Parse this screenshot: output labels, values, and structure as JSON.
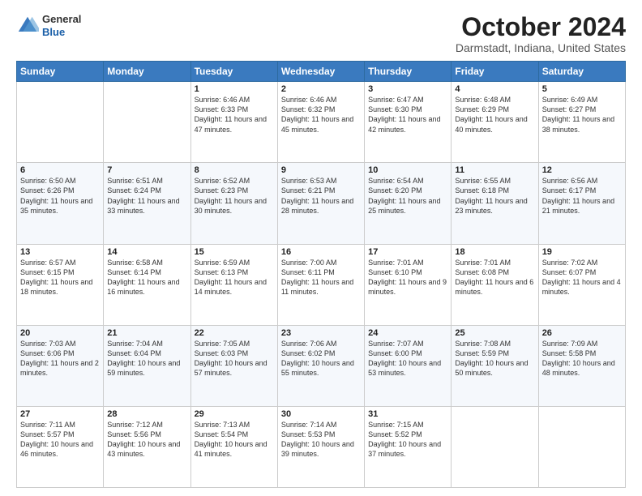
{
  "header": {
    "logo": {
      "general": "General",
      "blue": "Blue"
    },
    "title": "October 2024",
    "location": "Darmstadt, Indiana, United States"
  },
  "weekdays": [
    "Sunday",
    "Monday",
    "Tuesday",
    "Wednesday",
    "Thursday",
    "Friday",
    "Saturday"
  ],
  "weeks": [
    [
      {
        "day": "",
        "sunrise": "",
        "sunset": "",
        "daylight": ""
      },
      {
        "day": "",
        "sunrise": "",
        "sunset": "",
        "daylight": ""
      },
      {
        "day": "1",
        "sunrise": "Sunrise: 6:46 AM",
        "sunset": "Sunset: 6:33 PM",
        "daylight": "Daylight: 11 hours and 47 minutes."
      },
      {
        "day": "2",
        "sunrise": "Sunrise: 6:46 AM",
        "sunset": "Sunset: 6:32 PM",
        "daylight": "Daylight: 11 hours and 45 minutes."
      },
      {
        "day": "3",
        "sunrise": "Sunrise: 6:47 AM",
        "sunset": "Sunset: 6:30 PM",
        "daylight": "Daylight: 11 hours and 42 minutes."
      },
      {
        "day": "4",
        "sunrise": "Sunrise: 6:48 AM",
        "sunset": "Sunset: 6:29 PM",
        "daylight": "Daylight: 11 hours and 40 minutes."
      },
      {
        "day": "5",
        "sunrise": "Sunrise: 6:49 AM",
        "sunset": "Sunset: 6:27 PM",
        "daylight": "Daylight: 11 hours and 38 minutes."
      }
    ],
    [
      {
        "day": "6",
        "sunrise": "Sunrise: 6:50 AM",
        "sunset": "Sunset: 6:26 PM",
        "daylight": "Daylight: 11 hours and 35 minutes."
      },
      {
        "day": "7",
        "sunrise": "Sunrise: 6:51 AM",
        "sunset": "Sunset: 6:24 PM",
        "daylight": "Daylight: 11 hours and 33 minutes."
      },
      {
        "day": "8",
        "sunrise": "Sunrise: 6:52 AM",
        "sunset": "Sunset: 6:23 PM",
        "daylight": "Daylight: 11 hours and 30 minutes."
      },
      {
        "day": "9",
        "sunrise": "Sunrise: 6:53 AM",
        "sunset": "Sunset: 6:21 PM",
        "daylight": "Daylight: 11 hours and 28 minutes."
      },
      {
        "day": "10",
        "sunrise": "Sunrise: 6:54 AM",
        "sunset": "Sunset: 6:20 PM",
        "daylight": "Daylight: 11 hours and 25 minutes."
      },
      {
        "day": "11",
        "sunrise": "Sunrise: 6:55 AM",
        "sunset": "Sunset: 6:18 PM",
        "daylight": "Daylight: 11 hours and 23 minutes."
      },
      {
        "day": "12",
        "sunrise": "Sunrise: 6:56 AM",
        "sunset": "Sunset: 6:17 PM",
        "daylight": "Daylight: 11 hours and 21 minutes."
      }
    ],
    [
      {
        "day": "13",
        "sunrise": "Sunrise: 6:57 AM",
        "sunset": "Sunset: 6:15 PM",
        "daylight": "Daylight: 11 hours and 18 minutes."
      },
      {
        "day": "14",
        "sunrise": "Sunrise: 6:58 AM",
        "sunset": "Sunset: 6:14 PM",
        "daylight": "Daylight: 11 hours and 16 minutes."
      },
      {
        "day": "15",
        "sunrise": "Sunrise: 6:59 AM",
        "sunset": "Sunset: 6:13 PM",
        "daylight": "Daylight: 11 hours and 14 minutes."
      },
      {
        "day": "16",
        "sunrise": "Sunrise: 7:00 AM",
        "sunset": "Sunset: 6:11 PM",
        "daylight": "Daylight: 11 hours and 11 minutes."
      },
      {
        "day": "17",
        "sunrise": "Sunrise: 7:01 AM",
        "sunset": "Sunset: 6:10 PM",
        "daylight": "Daylight: 11 hours and 9 minutes."
      },
      {
        "day": "18",
        "sunrise": "Sunrise: 7:01 AM",
        "sunset": "Sunset: 6:08 PM",
        "daylight": "Daylight: 11 hours and 6 minutes."
      },
      {
        "day": "19",
        "sunrise": "Sunrise: 7:02 AM",
        "sunset": "Sunset: 6:07 PM",
        "daylight": "Daylight: 11 hours and 4 minutes."
      }
    ],
    [
      {
        "day": "20",
        "sunrise": "Sunrise: 7:03 AM",
        "sunset": "Sunset: 6:06 PM",
        "daylight": "Daylight: 11 hours and 2 minutes."
      },
      {
        "day": "21",
        "sunrise": "Sunrise: 7:04 AM",
        "sunset": "Sunset: 6:04 PM",
        "daylight": "Daylight: 10 hours and 59 minutes."
      },
      {
        "day": "22",
        "sunrise": "Sunrise: 7:05 AM",
        "sunset": "Sunset: 6:03 PM",
        "daylight": "Daylight: 10 hours and 57 minutes."
      },
      {
        "day": "23",
        "sunrise": "Sunrise: 7:06 AM",
        "sunset": "Sunset: 6:02 PM",
        "daylight": "Daylight: 10 hours and 55 minutes."
      },
      {
        "day": "24",
        "sunrise": "Sunrise: 7:07 AM",
        "sunset": "Sunset: 6:00 PM",
        "daylight": "Daylight: 10 hours and 53 minutes."
      },
      {
        "day": "25",
        "sunrise": "Sunrise: 7:08 AM",
        "sunset": "Sunset: 5:59 PM",
        "daylight": "Daylight: 10 hours and 50 minutes."
      },
      {
        "day": "26",
        "sunrise": "Sunrise: 7:09 AM",
        "sunset": "Sunset: 5:58 PM",
        "daylight": "Daylight: 10 hours and 48 minutes."
      }
    ],
    [
      {
        "day": "27",
        "sunrise": "Sunrise: 7:11 AM",
        "sunset": "Sunset: 5:57 PM",
        "daylight": "Daylight: 10 hours and 46 minutes."
      },
      {
        "day": "28",
        "sunrise": "Sunrise: 7:12 AM",
        "sunset": "Sunset: 5:56 PM",
        "daylight": "Daylight: 10 hours and 43 minutes."
      },
      {
        "day": "29",
        "sunrise": "Sunrise: 7:13 AM",
        "sunset": "Sunset: 5:54 PM",
        "daylight": "Daylight: 10 hours and 41 minutes."
      },
      {
        "day": "30",
        "sunrise": "Sunrise: 7:14 AM",
        "sunset": "Sunset: 5:53 PM",
        "daylight": "Daylight: 10 hours and 39 minutes."
      },
      {
        "day": "31",
        "sunrise": "Sunrise: 7:15 AM",
        "sunset": "Sunset: 5:52 PM",
        "daylight": "Daylight: 10 hours and 37 minutes."
      },
      {
        "day": "",
        "sunrise": "",
        "sunset": "",
        "daylight": ""
      },
      {
        "day": "",
        "sunrise": "",
        "sunset": "",
        "daylight": ""
      }
    ]
  ]
}
